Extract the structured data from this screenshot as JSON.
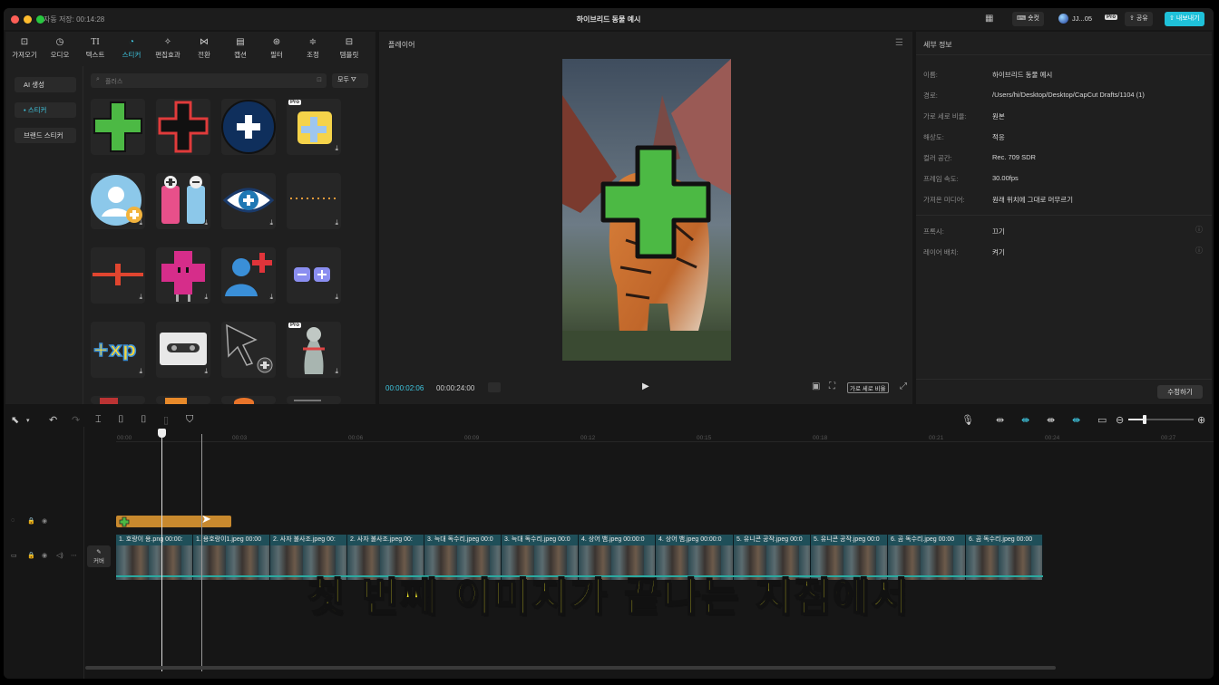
{
  "window": {
    "autosave": "자동 저장: 00:14:28",
    "title": "하이브리드 동물 예시"
  },
  "titlebar": {
    "shortcut": "숏컷",
    "user": "JJ...05",
    "pro_badge": "Pro",
    "share": "공유",
    "export": "내보내기"
  },
  "tabs": [
    {
      "label": "가져오기",
      "icon": "import-icon"
    },
    {
      "label": "오디오",
      "icon": "audio-icon"
    },
    {
      "label": "텍스트",
      "icon": "text-icon",
      "glyph": "TI"
    },
    {
      "label": "스티커",
      "icon": "sticker-icon",
      "active": true
    },
    {
      "label": "편집효과",
      "icon": "effects-icon"
    },
    {
      "label": "전환",
      "icon": "transition-icon"
    },
    {
      "label": "캡션",
      "icon": "caption-icon"
    },
    {
      "label": "필터",
      "icon": "filter-icon"
    },
    {
      "label": "조정",
      "icon": "adjust-icon"
    },
    {
      "label": "템플릿",
      "icon": "template-icon"
    }
  ],
  "sticker_nav": [
    {
      "label": "AI 생성"
    },
    {
      "label": "• 스티커"
    },
    {
      "label": "브랜드 스티커"
    }
  ],
  "search": {
    "placeholder": "플러스",
    "filter": "모두"
  },
  "player": {
    "title": "플레이어",
    "time_current": "00:00:02:06",
    "time_total": "00:00:24:00",
    "ratio_btn": "가로 세로 비율"
  },
  "details": {
    "title": "세부 정보",
    "rows": [
      {
        "label": "이름:",
        "value": "하이브리드 동물 예시"
      },
      {
        "label": "경로:",
        "value": "/Users/hi/Desktop/Desktop/CapCut Drafts/1104 (1)"
      },
      {
        "label": "가로 세로 비율:",
        "value": "원본"
      },
      {
        "label": "해상도:",
        "value": "적응"
      },
      {
        "label": "컬러 공간:",
        "value": "Rec. 709 SDR"
      },
      {
        "label": "프레임 속도:",
        "value": "30.00fps"
      },
      {
        "label": "가져온 미디어:",
        "value": "원래 위치에 그대로 머무르기"
      }
    ],
    "rows2": [
      {
        "label": "프록시:",
        "value": "끄기"
      },
      {
        "label": "레이어 배치:",
        "value": "켜기"
      }
    ],
    "edit_btn": "수정하기"
  },
  "ruler": [
    "00:00",
    "00:03",
    "00:06",
    "00:09",
    "00:12",
    "00:15",
    "00:18",
    "00:21",
    "00:24",
    "00:27"
  ],
  "cover_label": "커버",
  "clips": [
    "1. 호랑이 용.png",
    "00:00:",
    "1. 용호랑이1.jpeg",
    "00:00",
    "2. 사자 불사조.jpeg",
    "00:",
    "2. 사자 불사조.jpeg",
    "00:",
    "3. 늑대 독수리.jpeg",
    "00:0",
    "3. 늑대 독수리.jpeg",
    "00:0",
    "4. 상어 뱀.jpeg",
    "00:00:0",
    "4. 상어 뱀.jpeg",
    "00:00:0",
    "5. 유니콘 공작.jpeg",
    "00:0",
    "5. 유니콘 공작.jpeg",
    "00:0",
    "6. 곰 독수리.jpeg",
    "00:00",
    "6. 곰 독수리.jpeg",
    "00:00"
  ],
  "subtitle": "첫 번째 이미지가 끝나는 지점에서",
  "colors": {
    "accent": "#3fc6e0",
    "sticker_clip": "#c8892e",
    "video_clip": "#1f4f59",
    "plus_green": "#4cb944"
  }
}
